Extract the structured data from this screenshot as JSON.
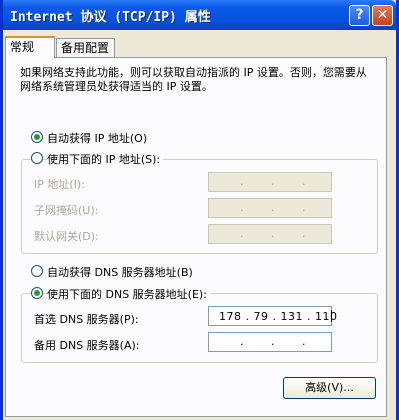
{
  "window": {
    "title": "Internet 协议 (TCP/IP) 属性",
    "help_glyph": "?",
    "close_glyph": "✕"
  },
  "tabs": [
    {
      "label": "常规"
    },
    {
      "label": "备用配置"
    }
  ],
  "description": "如果网络支持此功能，则可以获取自动指派的 IP 设置。否则，您需要从网络系统管理员处获得适当的 IP 设置。",
  "ip_section": {
    "auto_label": "自动获得 IP 地址(O)",
    "manual_label": "使用下面的 IP 地址(S):",
    "selected": "auto",
    "fields": [
      {
        "label": "IP 地址(I):",
        "value": ""
      },
      {
        "label": "子网掩码(U):",
        "value": ""
      },
      {
        "label": "默认网关(D):",
        "value": ""
      }
    ]
  },
  "dns_section": {
    "auto_label": "自动获得 DNS 服务器地址(B)",
    "manual_label": "使用下面的 DNS 服务器地址(E):",
    "selected": "manual",
    "fields": [
      {
        "label": "首选 DNS 服务器(P):",
        "value": "178 . 79 . 131 . 110"
      },
      {
        "label": "备用 DNS 服务器(A):",
        "value": ""
      }
    ]
  },
  "advanced_button": "高级(V)..."
}
